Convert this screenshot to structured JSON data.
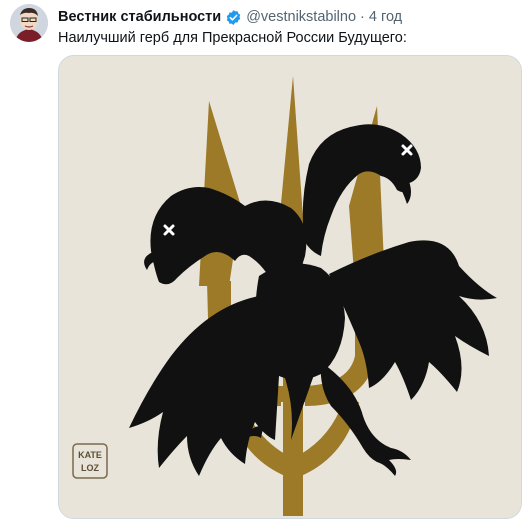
{
  "tweet": {
    "author_name": "Вестник стабильности",
    "handle": "@vestnikstabilno",
    "separator": "·",
    "time": "4 год",
    "text": "Наилучший герб для Прекрасной России Будущего:"
  },
  "media": {
    "artist_signature": "KATE LOZ",
    "colors": {
      "background": "#e8e4da",
      "trident": "#9c7a27",
      "eagle": "#111111"
    }
  },
  "icons": {
    "verified": "verified-badge-icon",
    "avatar": "avatar-image"
  },
  "colors": {
    "accent": "#1d9bf0",
    "text": "#0f1419",
    "muted": "#536471"
  }
}
